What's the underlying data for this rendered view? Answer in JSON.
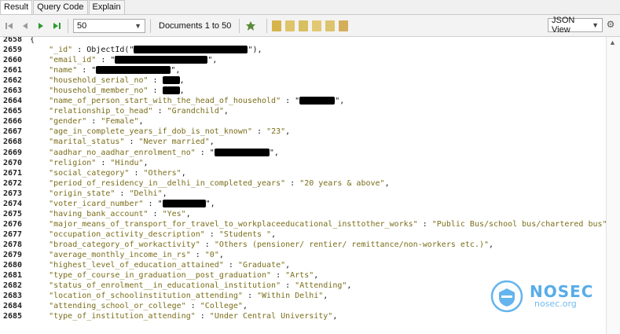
{
  "tabs": [
    {
      "label": "Result",
      "active": true
    },
    {
      "label": "Query Code",
      "active": false
    },
    {
      "label": "Explain",
      "active": false
    }
  ],
  "toolbar": {
    "page_size": "50",
    "documents_label": "Documents 1 to 50",
    "view_mode": "JSON View"
  },
  "icons": {
    "first": "first-page-icon",
    "prev": "previous-page-icon",
    "next": "next-page-icon",
    "last": "last-page-icon",
    "refresh": "refresh-icon",
    "settings": "gear-icon"
  },
  "colors": {
    "key": "#7a6d1a",
    "value": "#7a6d1a",
    "accent": "#3a9ee6"
  },
  "code": {
    "lines": [
      {
        "n": "2658",
        "open": "{"
      },
      {
        "n": "2659",
        "key": "\"_id\"",
        "sep": " : ObjectId(\"",
        "value": "",
        "redact": 145,
        "tail": "\"),"
      },
      {
        "n": "2660",
        "key": "\"email_id\"",
        "sep": " : \"",
        "value": "",
        "redact": 118,
        "tail": "\","
      },
      {
        "n": "2661",
        "key": "\"name\"",
        "sep": " : \"",
        "value": "",
        "redact": 95,
        "tail": "\","
      },
      {
        "n": "2662",
        "key": "\"household_serial_no\"",
        "sep": " : ",
        "value": "",
        "redact": 22,
        "tail": ","
      },
      {
        "n": "2663",
        "key": "\"household_member_no\"",
        "sep": " : ",
        "value": "",
        "redact": 22,
        "tail": ","
      },
      {
        "n": "2664",
        "key": "\"name_of_person_start_with_the_head_of_household\"",
        "sep": " : \"",
        "value": "",
        "redact": 45,
        "tail": "\","
      },
      {
        "n": "2665",
        "key": "\"relationship_to_head\"",
        "sep": " : ",
        "value": "\"Grandchild\"",
        "tail": ","
      },
      {
        "n": "2666",
        "key": "\"gender\"",
        "sep": " : ",
        "value": "\"Female\"",
        "tail": ","
      },
      {
        "n": "2667",
        "key": "\"age_in_complete_years_if_dob_is_not_known\"",
        "sep": " : ",
        "value": "\"23\"",
        "tail": ","
      },
      {
        "n": "2668",
        "key": "\"marital_status\"",
        "sep": " : ",
        "value": "\"Never married\"",
        "tail": ","
      },
      {
        "n": "2669",
        "key": "\"aadhar_no_aadhar_enrolment_no\"",
        "sep": " : \"",
        "value": "",
        "redact": 70,
        "tail": "\","
      },
      {
        "n": "2670",
        "key": "\"religion\"",
        "sep": " : ",
        "value": "\"Hindu\"",
        "tail": ","
      },
      {
        "n": "2671",
        "key": "\"social_category\"",
        "sep": " : ",
        "value": "\"Others\"",
        "tail": ","
      },
      {
        "n": "2672",
        "key": "\"period_of_residency_in__delhi_in_completed_years\"",
        "sep": " : ",
        "value": "\"20 years & above\"",
        "tail": ","
      },
      {
        "n": "2673",
        "key": "\"origin_state\"",
        "sep": " : ",
        "value": "\"Delhi\"",
        "tail": ","
      },
      {
        "n": "2674",
        "key": "\"voter_icard_number\"",
        "sep": " : \"",
        "value": "",
        "redact": 55,
        "tail": "\","
      },
      {
        "n": "2675",
        "key": "\"having_bank_account\"",
        "sep": " : ",
        "value": "\"Yes\"",
        "tail": ","
      },
      {
        "n": "2676",
        "key": "\"major_means_of_transport_for_travel_to_workplaceeducational_insttother_works\"",
        "sep": " : ",
        "value": "\"Public Bus/school bus/chartered bus\"",
        "tail": ","
      },
      {
        "n": "2677",
        "key": "\"occupation_activity_description\"",
        "sep": " : ",
        "value": "\"Students \"",
        "tail": ","
      },
      {
        "n": "2678",
        "key": "\"broad_category_of_workactivity\"",
        "sep": " : ",
        "value": "\"Others (pensioner/ rentier/ remittance/non-workers etc.)\"",
        "tail": ","
      },
      {
        "n": "2679",
        "key": "\"average_monthly_income_in_rs\"",
        "sep": " : ",
        "value": "\"0\"",
        "tail": ","
      },
      {
        "n": "2680",
        "key": "\"highest_level_of_education_attained\"",
        "sep": " : ",
        "value": "\"Graduate\"",
        "tail": ","
      },
      {
        "n": "2681",
        "key": "\"type_of_course_in_graduation__post_graduation\"",
        "sep": " : ",
        "value": "\"Arts\"",
        "tail": ","
      },
      {
        "n": "2682",
        "key": "\"status_of_enrolment__in_educational_institution\"",
        "sep": " : ",
        "value": "\"Attending\"",
        "tail": ","
      },
      {
        "n": "2683",
        "key": "\"location_of_schoolinstitution_attending\"",
        "sep": " : ",
        "value": "\"Within Delhi\"",
        "tail": ","
      },
      {
        "n": "2684",
        "key": "\"attending_school_or_college\"",
        "sep": " : ",
        "value": "\"College\"",
        "tail": ","
      },
      {
        "n": "2685",
        "key": "\"type_of_institution_attending\"",
        "sep": " : ",
        "value": "\"Under Central University\"",
        "tail": ","
      }
    ]
  },
  "watermark": {
    "title": "NOSEC",
    "subtitle": "nosec.org"
  }
}
